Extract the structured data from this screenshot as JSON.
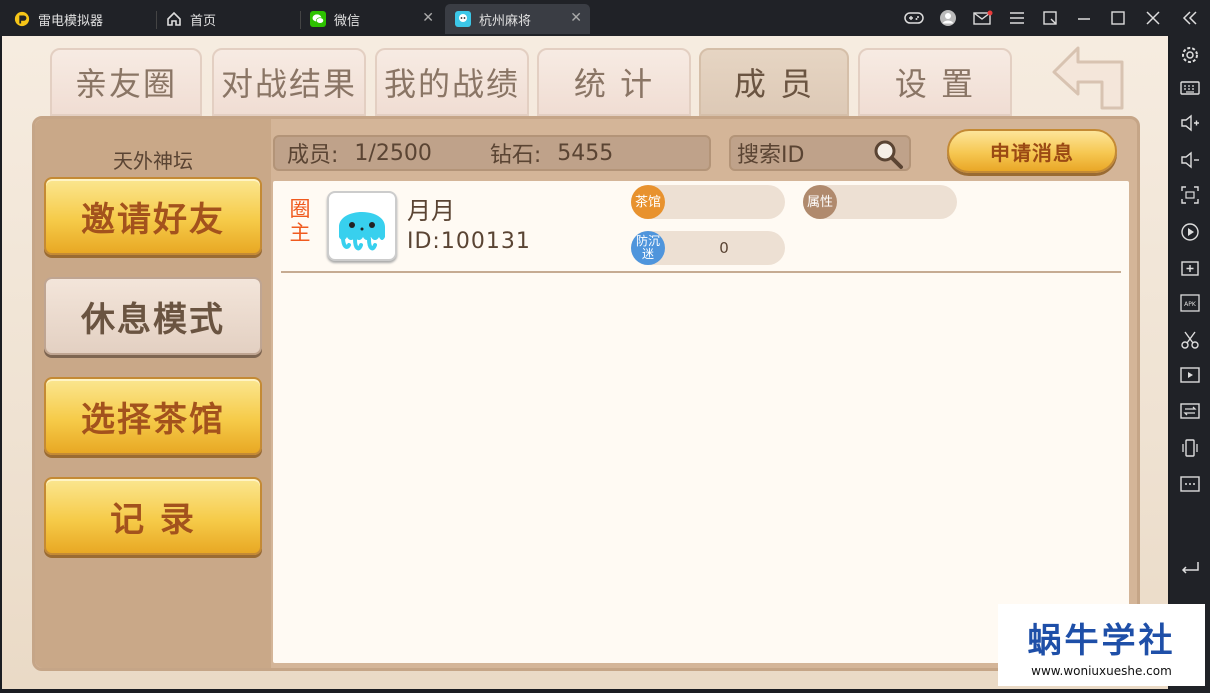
{
  "window": {
    "app_name": "雷电模拟器",
    "tabs": [
      {
        "label": "首页",
        "icon": "home-icon"
      },
      {
        "label": "微信",
        "icon": "wechat-icon"
      },
      {
        "label": "杭州麻将",
        "icon": "mahjong-app-icon"
      }
    ],
    "controls": [
      "gamepad-icon",
      "account-icon",
      "mail-icon",
      "menu-icon",
      "pin-window-icon",
      "minimize-icon",
      "maximize-icon",
      "close-icon",
      "collapse-sidebar-icon"
    ]
  },
  "sidebar_icons": [
    "settings-icon",
    "keyboard-icon",
    "volume-up-icon",
    "volume-down-icon",
    "screenshot-icon",
    "record-icon",
    "add-app-icon",
    "apk-install-icon",
    "scissors-icon",
    "video-icon",
    "sync-icon",
    "shake-icon",
    "more-icon",
    "back-icon"
  ],
  "game": {
    "tabs": [
      "亲友圈",
      "对战结果",
      "我的战绩",
      "统  计",
      "成  员",
      "设  置"
    ],
    "active_tab": "成  员",
    "club_name": "天外神坛",
    "side_buttons": [
      "邀请好友",
      "休息模式",
      "选择茶馆",
      "记    录"
    ],
    "members_label": "成员:",
    "members_value": "1/2500",
    "diamonds_label": "钻石:",
    "diamonds_value": "5455",
    "search_placeholder": "搜索ID",
    "apply_button": "申请消息",
    "members": [
      {
        "role": "圈主",
        "name": "月月",
        "id": "ID:100131",
        "teahouse_tag": "茶馆",
        "attribute_tag": "属性",
        "anti_addiction_tag": "防沉迷",
        "anti_addiction_value": "0"
      }
    ]
  },
  "watermark": {
    "title": "蜗牛学社",
    "url": "www.woniuxueshe.com"
  },
  "colors": {
    "titlebar": "#202227",
    "gold_button": "#f6cb49",
    "panel": "#d4b598",
    "role_text": "#f05a1e",
    "tag_orange": "#e8922e",
    "tag_brown": "#b08a6d",
    "tag_blue": "#4f95dc",
    "watermark_blue": "#1e4fa8"
  }
}
